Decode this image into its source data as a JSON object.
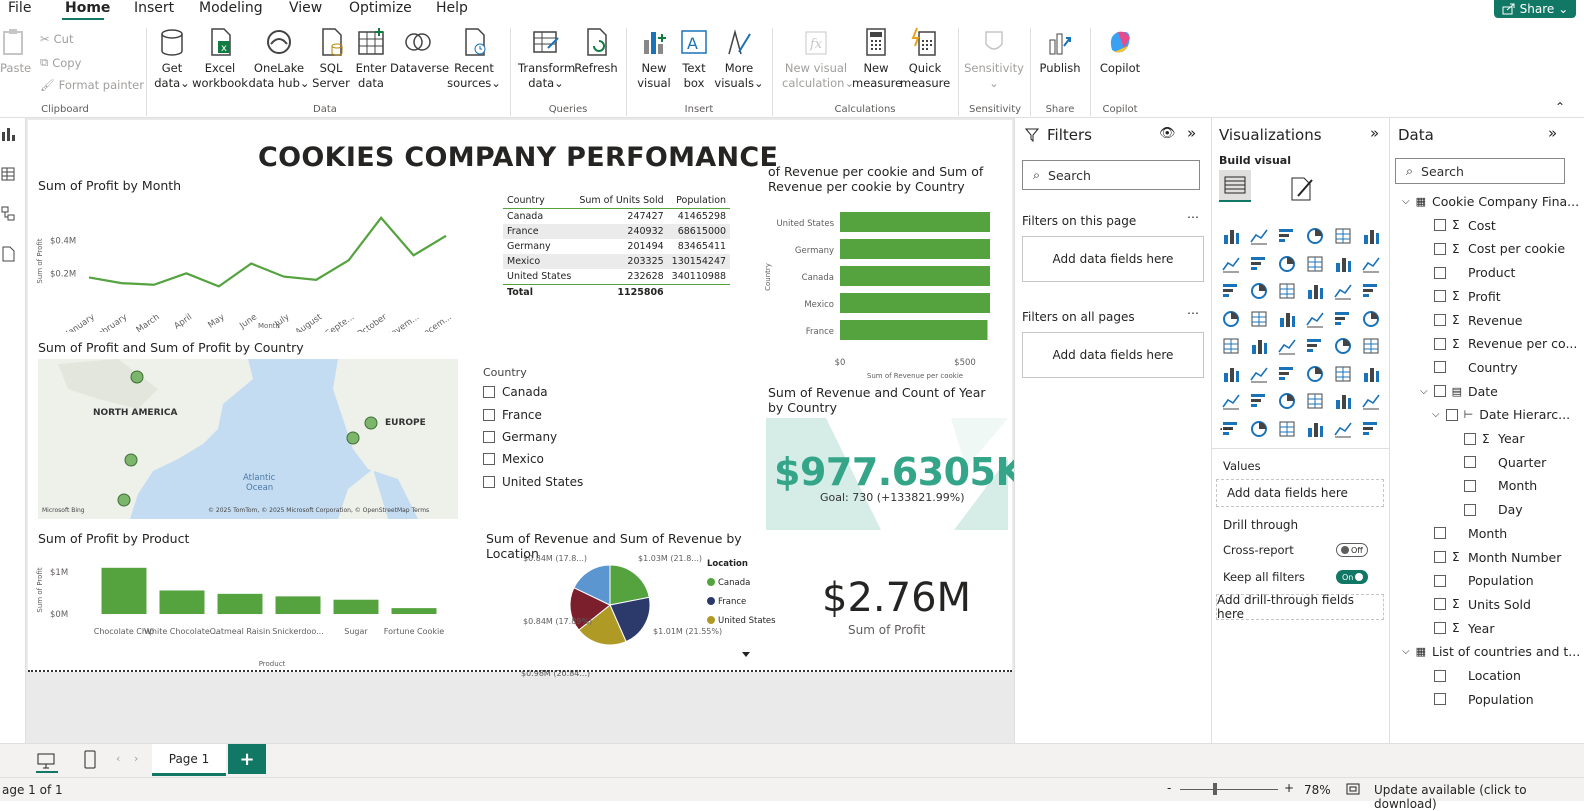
{
  "menu": {
    "items": [
      "File",
      "Home",
      "Insert",
      "Modeling",
      "View",
      "Optimize",
      "Help"
    ],
    "share": "Share"
  },
  "ribbon": {
    "clipboard": {
      "paste": "Paste",
      "cut": "Cut",
      "copy": "Copy",
      "format_painter": "Format painter",
      "group": "Clipboard"
    },
    "data": {
      "get_data": [
        "Get",
        "data"
      ],
      "excel": [
        "Excel",
        "workbook"
      ],
      "onelake": [
        "OneLake",
        "data hub"
      ],
      "sql": [
        "SQL",
        "Server"
      ],
      "enter": [
        "Enter",
        "data"
      ],
      "dataverse": [
        "Dataverse",
        ""
      ],
      "recent": [
        "Recent",
        "sources"
      ],
      "group": "Data"
    },
    "queries": {
      "transform": [
        "Transform",
        "data"
      ],
      "refresh": [
        "Refresh",
        ""
      ],
      "group": "Queries"
    },
    "insert": {
      "new_visual": [
        "New",
        "visual"
      ],
      "text_box": [
        "Text",
        "box"
      ],
      "more_visuals": [
        "More",
        "visuals"
      ],
      "group": "Insert"
    },
    "calculations": {
      "new_visual_calc": [
        "New visual",
        "calculation"
      ],
      "new_measure": [
        "New",
        "measure"
      ],
      "quick_measure": [
        "Quick",
        "measure"
      ],
      "group": "Calculations"
    },
    "sensitivity": {
      "label": "Sensitivity",
      "group": "Sensitivity"
    },
    "share": {
      "publish": "Publish",
      "group": "Share"
    },
    "copilot": {
      "label": "Copilot",
      "group": "Copilot"
    }
  },
  "report": {
    "title": "COOKIES COMPANY PERFOMANCE",
    "line_title": "Sum of Profit by Month",
    "map_title": "Sum of Profit and Sum of Profit by Country",
    "map_labels": {
      "na": "NORTH AMERICA",
      "eu": "EUROPE",
      "ocean1": "Atlantic",
      "ocean2": "Ocean",
      "attrib": "© 2025 TomTom, © 2025 Microsoft Corporation, © OpenStreetMap  Terms",
      "brand": "Microsoft Bing"
    },
    "product_title": "Sum of Profit by Product",
    "pie_title": "Sum of Revenue and Sum of Revenue by Location",
    "bar_title": "of Revenue per cookie and Sum of Revenue per cookie by Country",
    "kpi_title": "Sum of Revenue and Count of Year by Country",
    "kpi_value": "$977.6305K",
    "kpi_goal": "Goal: 730 (+133821.99%)",
    "card_value": "$2.76M",
    "card_label": "Sum of  Profit",
    "slicer": {
      "title": "Country",
      "items": [
        "Canada",
        "France",
        "Germany",
        "Mexico",
        "United States"
      ]
    },
    "table": {
      "headers": [
        "Country",
        "Sum of Units Sold",
        "Population"
      ],
      "rows": [
        [
          "Canada",
          "247427",
          "41465298"
        ],
        [
          "France",
          "240932",
          "68615000"
        ],
        [
          "Germany",
          "201494",
          "83465411"
        ],
        [
          "Mexico",
          "203325",
          "130154247"
        ],
        [
          "United States",
          "232628",
          "340110988"
        ]
      ],
      "total": [
        "Total",
        "1125806",
        ""
      ]
    }
  },
  "chart_data": [
    {
      "type": "line",
      "title": "Sum of Profit by Month",
      "categories": [
        "January",
        "February",
        "March",
        "April",
        "May",
        "June",
        "July",
        "August",
        "Septe...",
        "October",
        "Novem...",
        "Decem..."
      ],
      "values": [
        0.175,
        0.14,
        0.13,
        0.2,
        0.12,
        0.26,
        0.18,
        0.16,
        0.28,
        0.54,
        0.31,
        0.43
      ],
      "unit": "M",
      "ylabel": "Sum of Profit",
      "xlabel": "Month",
      "yticks": [
        "$0.2M",
        "$0.4M"
      ],
      "color": "#54a33f"
    },
    {
      "type": "bar",
      "title": "Sum of Profit by Product",
      "categories": [
        "Chocolate Chip",
        "White Chocolate ...",
        "Oatmeal Raisin",
        "Snickerdoo...",
        "Sugar",
        "Fortune Cookie"
      ],
      "values": [
        1.1,
        0.56,
        0.48,
        0.42,
        0.34,
        0.14
      ],
      "unit": "M",
      "ylabel": "Sum of Profit",
      "xlabel": "Product",
      "yticks": [
        "$0M",
        "$1M"
      ],
      "color": "#54a33f"
    },
    {
      "type": "bar",
      "orientation": "horizontal",
      "title": "of Revenue per cookie and Sum of Revenue per cookie by Country",
      "categories": [
        "United States",
        "Germany",
        "Canada",
        "Mexico",
        "France"
      ],
      "values": [
        600,
        600,
        600,
        600,
        590
      ],
      "xlabel": "Sum of Revenue per cookie",
      "ylabel": "Country",
      "xticks": [
        "$0",
        "$500"
      ],
      "color": "#54a33f"
    },
    {
      "type": "pie",
      "title": "Sum of Revenue and Sum of Revenue by Location",
      "legend_title": "Location",
      "legend": [
        "Canada",
        "France",
        "United States"
      ],
      "slices": [
        {
          "value": 1.03,
          "label": "$1.03M (21.8...)",
          "color": "#54a33f"
        },
        {
          "value": 1.01,
          "label": "$1.01M (21.55%)",
          "color": "#2c3a6b"
        },
        {
          "value": 0.98,
          "label": "$0.98M (20.84...)",
          "color": "#b09a26"
        },
        {
          "value": 0.84,
          "label": "$0.84M (17.89%)",
          "color": "#7a1f2b"
        },
        {
          "value": 0.84,
          "label": "$0.84M (17.8...)",
          "color": "#5b96d1"
        }
      ]
    }
  ],
  "filters": {
    "title": "Filters",
    "search": "Search",
    "on_page": "Filters on this page",
    "on_all": "Filters on all pages",
    "add": "Add data fields here"
  },
  "viz": {
    "title": "Visualizations",
    "build": "Build visual",
    "values": "Values",
    "add": "Add data fields here",
    "drill": "Drill through",
    "cross": "Cross-report",
    "cross_state": "Off",
    "keep": "Keep all filters",
    "keep_state": "On",
    "add_drill": "Add drill-through fields here",
    "more": "..."
  },
  "data_pane": {
    "title": "Data",
    "search": "Search",
    "fields": [
      {
        "label": "Cookie Company Fina...",
        "type": "table",
        "indent": 0
      },
      {
        "label": "Cost",
        "type": "sigma",
        "indent": 1
      },
      {
        "label": "Cost per cookie",
        "type": "sigma",
        "indent": 1
      },
      {
        "label": "Product",
        "type": "plain",
        "indent": 1
      },
      {
        "label": "Profit",
        "type": "sigma",
        "indent": 1
      },
      {
        "label": "Revenue",
        "type": "sigma",
        "indent": 1
      },
      {
        "label": "Revenue per co...",
        "type": "sigma",
        "indent": 1
      },
      {
        "label": "Country",
        "type": "plain",
        "indent": 1
      },
      {
        "label": "Date",
        "type": "date",
        "indent": 1
      },
      {
        "label": "Date Hierarc...",
        "type": "hier",
        "indent": 2
      },
      {
        "label": "Year",
        "type": "sigma",
        "indent": 3
      },
      {
        "label": "Quarter",
        "type": "plain",
        "indent": 3
      },
      {
        "label": "Month",
        "type": "plain",
        "indent": 3
      },
      {
        "label": "Day",
        "type": "plain",
        "indent": 3
      },
      {
        "label": "Month",
        "type": "plain",
        "indent": 1
      },
      {
        "label": "Month Number",
        "type": "sigma",
        "indent": 1
      },
      {
        "label": "Population",
        "type": "plain",
        "indent": 1
      },
      {
        "label": "Units Sold",
        "type": "sigma",
        "indent": 1
      },
      {
        "label": "Year",
        "type": "sigma",
        "indent": 1
      },
      {
        "label": "List of countries and t...",
        "type": "table",
        "indent": 0
      },
      {
        "label": "Location",
        "type": "plain",
        "indent": 1
      },
      {
        "label": "Population",
        "type": "plain",
        "indent": 1
      }
    ]
  },
  "pages": {
    "tab": "Page 1",
    "add": "+"
  },
  "status": {
    "page": "age 1 of 1",
    "zoom": "78%",
    "update": "Update available (click to download)",
    "minus": "-",
    "plus": "+"
  }
}
